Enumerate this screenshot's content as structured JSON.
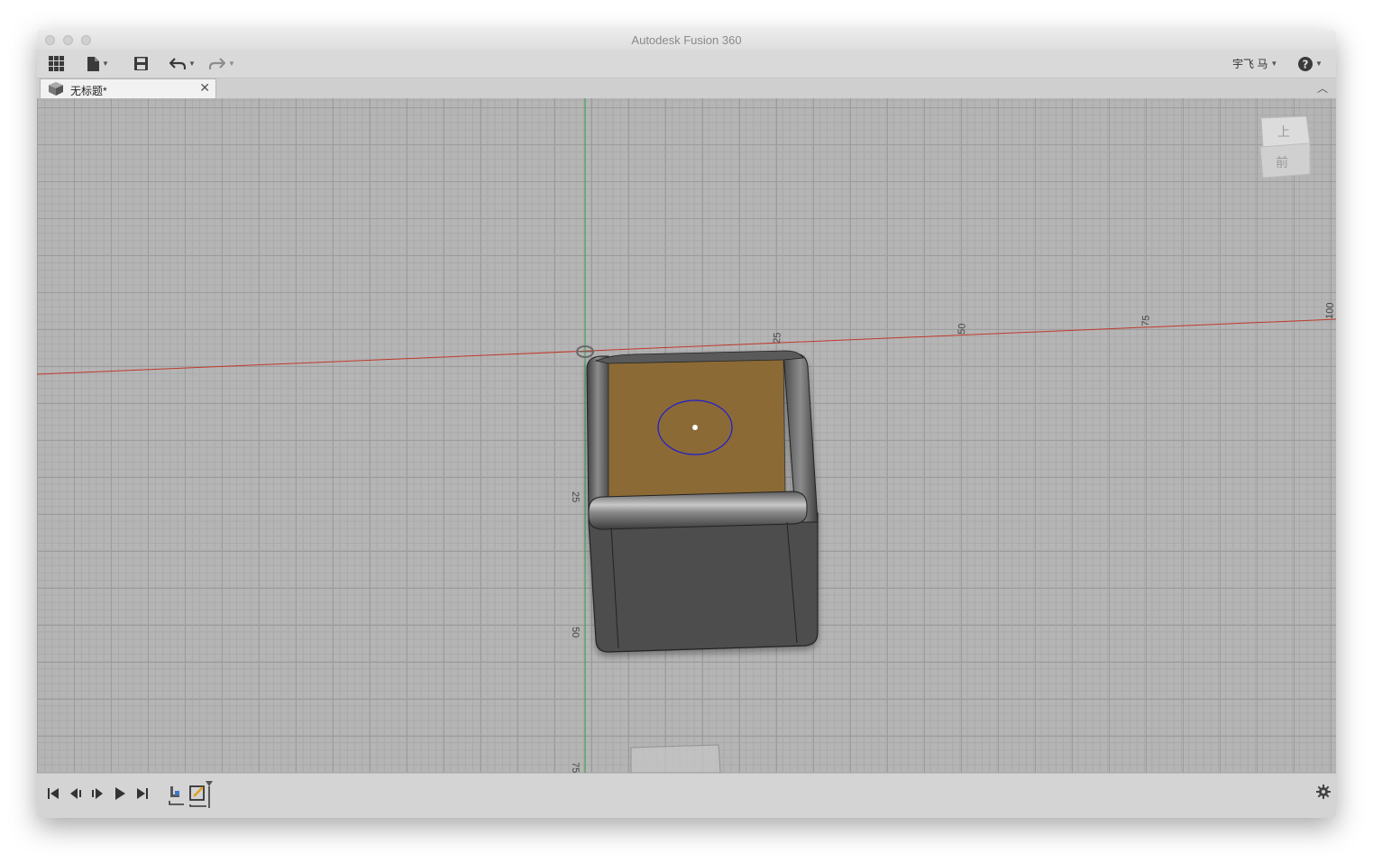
{
  "window": {
    "title": "Autodesk Fusion 360"
  },
  "toolbar": {
    "user_label": "宇飞 马",
    "icons": [
      "apps-grid-icon",
      "file-icon",
      "save-icon",
      "undo-icon",
      "redo-icon",
      "help-icon"
    ]
  },
  "tabs": [
    {
      "label": "无标题*",
      "icon": "component-icon",
      "active": true
    }
  ],
  "viewport": {
    "x_axis_ticks": [
      "25",
      "50",
      "75",
      "100"
    ],
    "y_axis_ticks": [
      "25",
      "50",
      "75"
    ],
    "viewcube": {
      "top_label": "上",
      "front_label": "前"
    },
    "colors": {
      "x_axis": "#c0392b",
      "y_axis": "#2e9e40",
      "selected_face": "#8b6b35",
      "body": "#4f4f4f",
      "sketch_circle": "#1f1fd0"
    }
  },
  "timeline": {
    "controls": [
      "skip-to-start-icon",
      "step-back-icon",
      "step-forward-icon",
      "play-icon",
      "skip-to-end-icon"
    ],
    "features": [
      "fillet-feature-icon",
      "sketch-feature-icon"
    ]
  }
}
